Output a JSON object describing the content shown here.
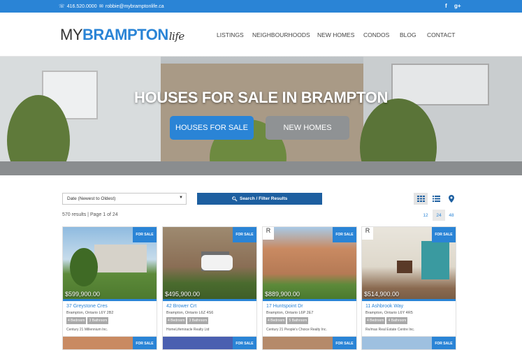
{
  "topbar": {
    "phone": "416.520.0000",
    "email": "robbie@mybramptonlife.ca",
    "social": [
      "f",
      "g+"
    ]
  },
  "logo": {
    "my": "MY",
    "brampton": "BRAMPTON",
    "life": "life"
  },
  "nav": [
    "LISTINGS",
    "NEIGHBOURHOODS",
    "NEW HOMES",
    "CONDOS",
    "BLOG",
    "CONTACT"
  ],
  "hero": {
    "title": "HOUSES FOR SALE IN BRAMPTON",
    "btn_primary": "HOUSES FOR SALE",
    "btn_secondary": "NEW HOMES"
  },
  "controls": {
    "sort_selected": "Date (Newest to Oldest)",
    "search_label": "Search / Filter Results",
    "results_text": "570 results | Page 1 of 24",
    "per_page": [
      "12",
      "24",
      "48"
    ],
    "per_page_active": "24"
  },
  "colors": {
    "accent": "#2a84d6",
    "dark_blue": "#1d5fa0",
    "tag_gray": "#a9a9a9"
  },
  "listings": [
    {
      "price": "$599,900.00",
      "address": "37 Greystone Cres",
      "city": "Brampton, Ontario L6Y 2B2",
      "beds": "4 Bedroom",
      "baths": "3 Bathroom",
      "broker": "Century 21 Millennium Inc.",
      "badge": "FOR SALE"
    },
    {
      "price": "$495,900.00",
      "address": "42 Brower Crt",
      "city": "Brampton, Ontario L6Z 4S6",
      "beds": "4 Bedroom",
      "baths": "3 Bathroom",
      "broker": "HomeLifemiracle Realty Ltd",
      "badge": "FOR SALE"
    },
    {
      "price": "$889,900.00",
      "address": "17 Huntspoint Dr",
      "city": "Brampton, Ontario L6P 2E7",
      "beds": "4 Bedroom",
      "baths": "5 Bathroom",
      "broker": "Century 21 People's Choice Realty Inc.",
      "badge": "FOR SALE"
    },
    {
      "price": "$514,900.00",
      "address": "11 Ashbrook Way",
      "city": "Brampton, Ontario L6Y 4R5",
      "beds": "4 Bedroom",
      "baths": "4 Bathroom",
      "broker": "Re/max Real Estate Centre Inc.",
      "badge": "FOR SALE"
    }
  ],
  "listings_row2_badges": [
    "FOR SALE",
    "FOR SALE",
    "FOR SALE",
    "FOR SALE"
  ]
}
